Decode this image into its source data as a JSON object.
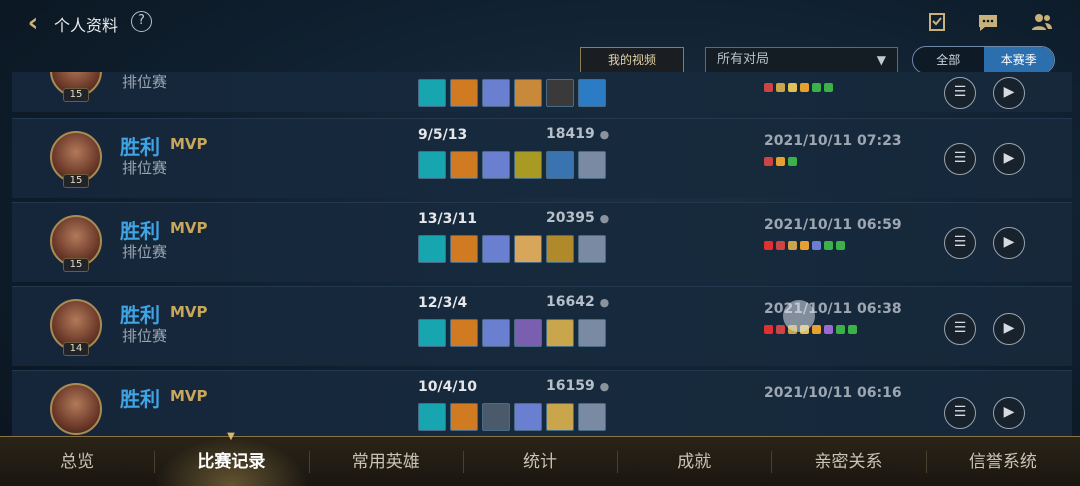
{
  "header": {
    "title": "个人资料",
    "help": "?"
  },
  "filters": {
    "my_videos": "我的视频",
    "match_select": "所有对局",
    "toggle_all": "全部",
    "toggle_season": "本赛季"
  },
  "rows": [
    {
      "level": "15",
      "mode": "排位赛",
      "result": "",
      "mvp": "",
      "kda": "",
      "gold": "",
      "date": ""
    },
    {
      "level": "15",
      "result": "胜利",
      "mvp": "MVP",
      "mode": "排位赛",
      "kda": "9/5/13",
      "gold": "18419",
      "date": "2021/10/11 07:23"
    },
    {
      "level": "15",
      "result": "胜利",
      "mvp": "MVP",
      "mode": "排位赛",
      "kda": "13/3/11",
      "gold": "20395",
      "date": "2021/10/11 06:59"
    },
    {
      "level": "14",
      "result": "胜利",
      "mvp": "MVP",
      "mode": "排位赛",
      "kda": "12/3/4",
      "gold": "16642",
      "date": "2021/10/11 06:38"
    },
    {
      "level": "",
      "result": "胜利",
      "mvp": "MVP",
      "mode": "",
      "kda": "10/4/10",
      "gold": "16159",
      "date": "2021/10/11 06:16"
    }
  ],
  "nav": [
    "总览",
    "比赛记录",
    "常用英雄",
    "统计",
    "成就",
    "亲密关系",
    "信誉系统"
  ],
  "colors": {
    "accent": "#2c6fae",
    "win": "#3fa4e6",
    "gold": "#c8a65a"
  }
}
